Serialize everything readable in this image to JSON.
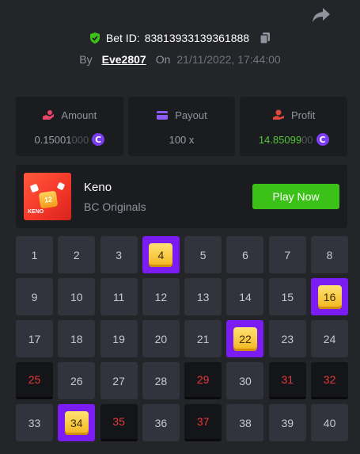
{
  "header": {
    "bet_label": "Bet ID:",
    "bet_id": "83813933139361888",
    "by_label": "By",
    "username": "Eve2807",
    "on_label": "On",
    "datetime": "21/11/2022, 17:44:00"
  },
  "stats": {
    "amount": {
      "label": "Amount",
      "value_main": "0.15001",
      "value_dim": "000"
    },
    "payout": {
      "label": "Payout",
      "value": "100 x"
    },
    "profit": {
      "label": "Profit",
      "value_main": "14.85099",
      "value_dim": "00"
    }
  },
  "coin_symbol": "C",
  "game": {
    "thumb_number": "12",
    "thumb_word": "KENO",
    "title": "Keno",
    "subtitle": "BC Originals",
    "play_label": "Play Now"
  },
  "grid": {
    "cells": [
      {
        "n": "1",
        "state": "normal"
      },
      {
        "n": "2",
        "state": "normal"
      },
      {
        "n": "3",
        "state": "normal"
      },
      {
        "n": "4",
        "state": "hit"
      },
      {
        "n": "5",
        "state": "normal"
      },
      {
        "n": "6",
        "state": "normal"
      },
      {
        "n": "7",
        "state": "normal"
      },
      {
        "n": "8",
        "state": "normal"
      },
      {
        "n": "9",
        "state": "normal"
      },
      {
        "n": "10",
        "state": "normal"
      },
      {
        "n": "11",
        "state": "normal"
      },
      {
        "n": "12",
        "state": "normal"
      },
      {
        "n": "13",
        "state": "normal"
      },
      {
        "n": "14",
        "state": "normal"
      },
      {
        "n": "15",
        "state": "normal"
      },
      {
        "n": "16",
        "state": "hit"
      },
      {
        "n": "17",
        "state": "normal"
      },
      {
        "n": "18",
        "state": "normal"
      },
      {
        "n": "19",
        "state": "normal"
      },
      {
        "n": "20",
        "state": "normal"
      },
      {
        "n": "21",
        "state": "normal"
      },
      {
        "n": "22",
        "state": "hit"
      },
      {
        "n": "23",
        "state": "normal"
      },
      {
        "n": "24",
        "state": "normal"
      },
      {
        "n": "25",
        "state": "miss"
      },
      {
        "n": "26",
        "state": "normal"
      },
      {
        "n": "27",
        "state": "normal"
      },
      {
        "n": "28",
        "state": "normal"
      },
      {
        "n": "29",
        "state": "miss"
      },
      {
        "n": "30",
        "state": "normal"
      },
      {
        "n": "31",
        "state": "miss"
      },
      {
        "n": "32",
        "state": "miss"
      },
      {
        "n": "33",
        "state": "normal"
      },
      {
        "n": "34",
        "state": "hit"
      },
      {
        "n": "35",
        "state": "miss"
      },
      {
        "n": "36",
        "state": "normal"
      },
      {
        "n": "37",
        "state": "miss"
      },
      {
        "n": "38",
        "state": "normal"
      },
      {
        "n": "39",
        "state": "normal"
      },
      {
        "n": "40",
        "state": "normal"
      }
    ]
  },
  "colors": {
    "background": "#232529",
    "panel": "#1b1c20",
    "cell": "#31343c",
    "hit_border": "#7a1cf2",
    "gem": "#f3b51c",
    "miss_text": "#e53a3a",
    "profit_green": "#54c63a",
    "play_button": "#3bc117",
    "amount_icon": "#e8476a",
    "payout_icon": "#8b5cf6",
    "profit_icon": "#e0473f",
    "shield_green": "#3bc117"
  },
  "icons": {
    "share": "share-icon",
    "shield": "shield-check-icon",
    "copy": "copy-icon",
    "amount": "coins-hand-icon",
    "payout": "wallet-icon",
    "profit": "profit-hand-icon",
    "coin": "bc-coin-icon"
  }
}
